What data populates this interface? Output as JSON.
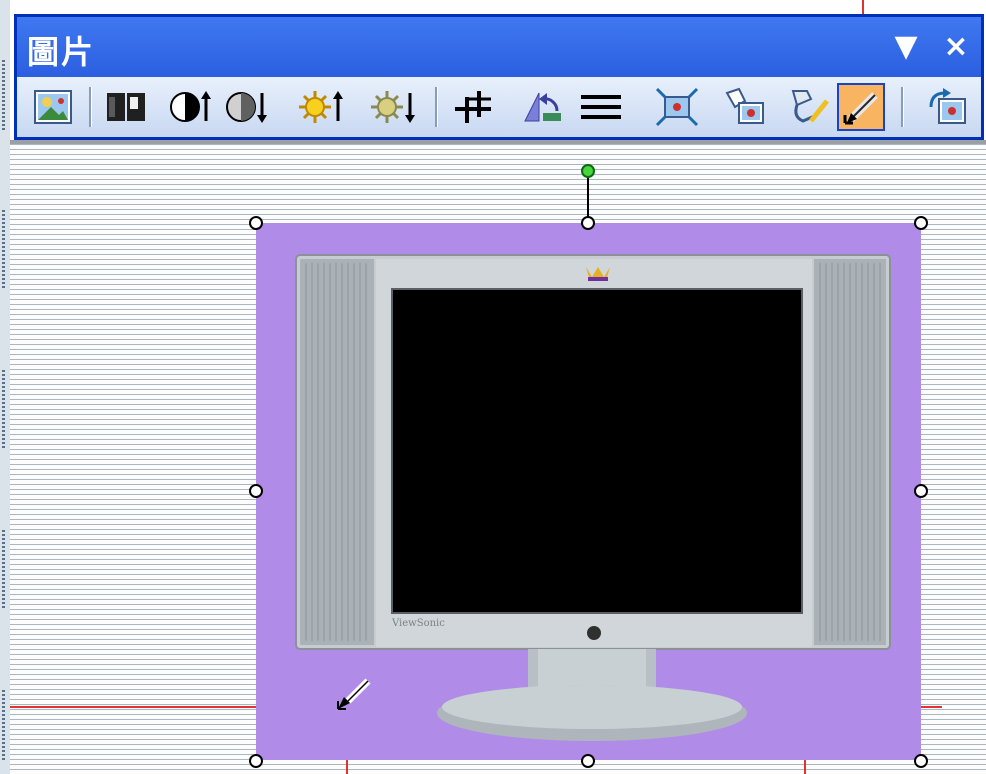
{
  "window": {
    "title": "圖片",
    "dropdown_glyph": "▼",
    "close_glyph": "×"
  },
  "toolbar_buttons": [
    {
      "name": "insert-picture",
      "icon": "insert-picture-icon"
    },
    {
      "name": "color",
      "icon": "color-icon"
    },
    {
      "name": "more-contrast",
      "icon": "more-contrast-icon"
    },
    {
      "name": "less-contrast",
      "icon": "less-contrast-icon"
    },
    {
      "name": "more-brightness",
      "icon": "more-brightness-icon"
    },
    {
      "name": "less-brightness",
      "icon": "less-brightness-icon"
    },
    {
      "name": "crop",
      "icon": "crop-icon"
    },
    {
      "name": "rotate-left",
      "icon": "rotate-left-icon"
    },
    {
      "name": "line-style",
      "icon": "line-style-icon"
    },
    {
      "name": "compress-pictures",
      "icon": "compress-pictures-icon"
    },
    {
      "name": "format-picture",
      "icon": "format-picture-icon"
    },
    {
      "name": "set-transparent-color",
      "icon": "set-transparent-color-icon"
    },
    {
      "name": "recolor",
      "icon": "recolor-pencil-icon",
      "active": true
    },
    {
      "name": "reset-picture",
      "icon": "reset-picture-icon"
    }
  ],
  "colors": {
    "titlebar": "#3f78f0",
    "active_button": "#f8b460",
    "picture_background": "#b08be8",
    "guide_line": "#e0342c"
  },
  "monitor": {
    "brand_text": "ViewSonic"
  }
}
